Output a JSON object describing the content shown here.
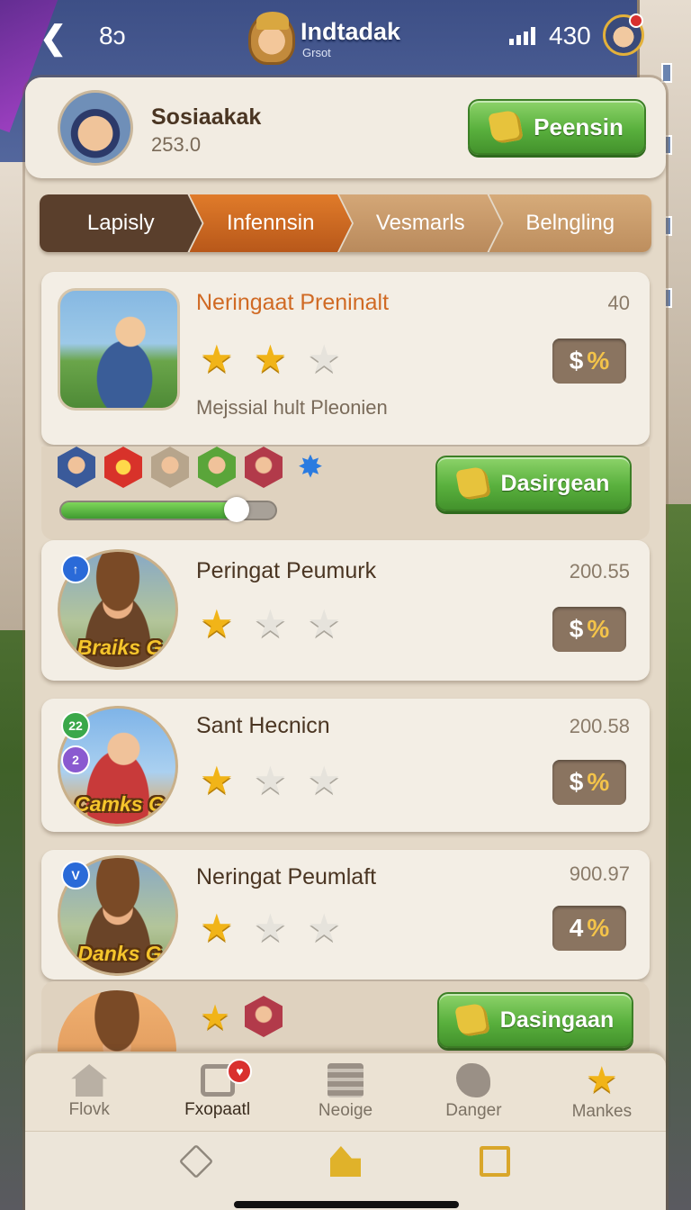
{
  "topbar": {
    "back_icon": "back-arrow-icon",
    "left_count": "8ↄ",
    "title": "Indtadak",
    "subtitle": "Grsot",
    "right_count": "430"
  },
  "profile": {
    "name": "Sosiaakak",
    "score": "253.0",
    "button_label": "Peensin"
  },
  "tabs": [
    {
      "label": "Lapisly"
    },
    {
      "label": "Infennsin"
    },
    {
      "label": "Vesmarls"
    },
    {
      "label": "Belngling"
    }
  ],
  "active_tab": 1,
  "cards": [
    {
      "title": "Neringaat Preninalt",
      "value": "40",
      "stars": 2,
      "max_stars": 3,
      "pct": "%",
      "desc": "Mejssial hult Pleonien"
    },
    {
      "title": "Peringat Peumurk",
      "value": "200.55",
      "stars": 1,
      "max_stars": 3,
      "pct": "%",
      "thumb_label": "Braiks G"
    },
    {
      "title": "Sant Hecnicn",
      "value": "200.58",
      "stars": 1,
      "max_stars": 3,
      "pct": "%",
      "thumb_label": "Camks G",
      "badge_a": "22"
    },
    {
      "title": "Neringat Peumlaft",
      "value": "900.97",
      "stars": 1,
      "max_stars": 3,
      "pct": "%",
      "pct_num": "4",
      "thumb_label": "Danks G"
    }
  ],
  "strip": {
    "button_label": "Dasirgean",
    "progress": 0.82
  },
  "peek": {
    "button_label": "Dasingaan"
  },
  "bottom_nav": [
    {
      "label": "Flovk",
      "icon": "house-icon"
    },
    {
      "label": "Fxopaatl",
      "icon": "inbox-icon",
      "active": true
    },
    {
      "label": "Neoige",
      "icon": "cards-stack-icon"
    },
    {
      "label": "Danger",
      "icon": "blob-icon"
    },
    {
      "label": "Mankes",
      "icon": "star-icon"
    }
  ],
  "colors": {
    "accent_orange": "#e07b2a",
    "button_green": "#59b03d",
    "star_gold": "#f1b418",
    "panel_bg": "#e4d9c8"
  }
}
